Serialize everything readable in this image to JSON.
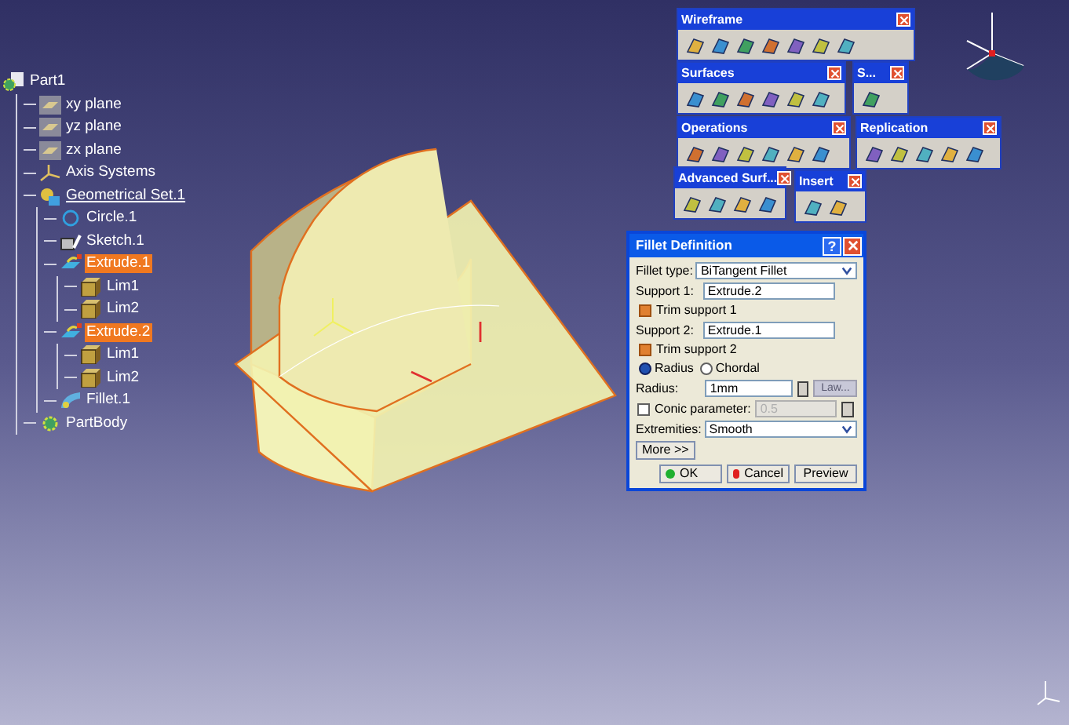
{
  "tree": [
    {
      "label": "Part1",
      "kind": "part",
      "selected": false,
      "underlined": false,
      "children": [
        {
          "label": "xy plane",
          "kind": "plane",
          "selected": false,
          "underlined": false
        },
        {
          "label": "yz plane",
          "kind": "plane",
          "selected": false,
          "underlined": false
        },
        {
          "label": "zx plane",
          "kind": "plane",
          "selected": false,
          "underlined": false
        },
        {
          "label": "Axis Systems",
          "kind": "axis",
          "selected": false,
          "underlined": false
        },
        {
          "label": "Geometrical Set.1",
          "kind": "set",
          "selected": false,
          "underlined": true,
          "children": [
            {
              "label": "Circle.1",
              "kind": "circle",
              "selected": false,
              "underlined": false
            },
            {
              "label": "Sketch.1",
              "kind": "sketch",
              "selected": false,
              "underlined": false
            },
            {
              "label": "Extrude.1",
              "kind": "extrude",
              "selected": true,
              "underlined": false,
              "children": [
                {
                  "label": "Lim1",
                  "kind": "limit",
                  "selected": false,
                  "underlined": false
                },
                {
                  "label": "Lim2",
                  "kind": "limit",
                  "selected": false,
                  "underlined": false
                }
              ]
            },
            {
              "label": "Extrude.2",
              "kind": "extrude",
              "selected": true,
              "underlined": false,
              "children": [
                {
                  "label": "Lim1",
                  "kind": "limit",
                  "selected": false,
                  "underlined": false
                },
                {
                  "label": "Lim2",
                  "kind": "limit",
                  "selected": false,
                  "underlined": false
                }
              ]
            },
            {
              "label": "Fillet.1",
              "kind": "fillet",
              "selected": false,
              "underlined": false
            }
          ]
        },
        {
          "label": "PartBody",
          "kind": "body",
          "selected": false,
          "underlined": false
        }
      ]
    }
  ],
  "toolbars": [
    {
      "title": "Wireframe"
    },
    {
      "title": "Surfaces"
    },
    {
      "title": "S..."
    },
    {
      "title": "Operations"
    },
    {
      "title": "Replication"
    },
    {
      "title": "Advanced Surf..."
    },
    {
      "title": "Insert"
    }
  ],
  "dialog": {
    "title": "Fillet Definition",
    "help": "?",
    "fillet_type_label": "Fillet type:",
    "fillet_type": "BiTangent Fillet",
    "support1_label": "Support 1:",
    "support1": "Extrude.2",
    "trim1_label": "Trim support 1",
    "trim1_checked": true,
    "support2_label": "Support 2:",
    "support2": "Extrude.1",
    "trim2_label": "Trim support 2",
    "trim2_checked": true,
    "modes": [
      {
        "label": "Radius",
        "selected": true
      },
      {
        "label": "Chordal",
        "selected": false
      }
    ],
    "radius_label": "Radius:",
    "radius": "1mm",
    "law_button": "Law...",
    "conic_label": "Conic parameter:",
    "conic_checked": false,
    "conic": "0.5",
    "extremities_label": "Extremities:",
    "extremities": "Smooth",
    "more_button": "More >>",
    "ok_button": "OK",
    "cancel_button": "Cancel",
    "preview_button": "Preview"
  }
}
